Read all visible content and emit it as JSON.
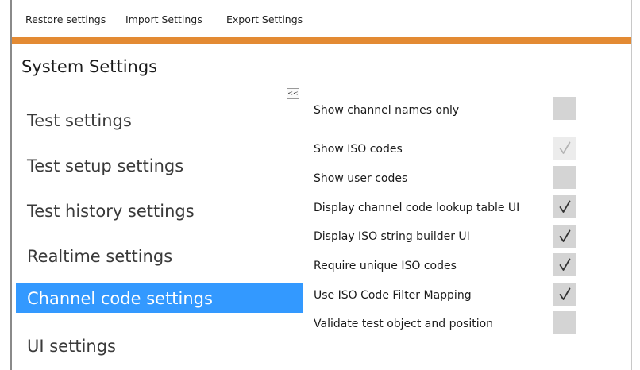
{
  "menu": {
    "restore": "Restore settings",
    "import": "Import Settings",
    "export": "Export Settings"
  },
  "title": "System Settings",
  "collapse_button": "<<",
  "colors": {
    "accent_band": "#e38a33",
    "selected_nav": "#3399ff",
    "checkbox_bg": "#d4d4d4"
  },
  "nav": {
    "items": [
      {
        "label": "Test settings",
        "selected": false
      },
      {
        "label": "Test setup settings",
        "selected": false
      },
      {
        "label": "Test history settings",
        "selected": false
      },
      {
        "label": "Realtime settings",
        "selected": false
      },
      {
        "label": "Channel code settings",
        "selected": true
      },
      {
        "label": "UI settings",
        "selected": false
      }
    ]
  },
  "settings": [
    {
      "label": "Show channel names only",
      "checked": false,
      "enabled": true
    },
    {
      "label": "Show ISO codes",
      "checked": true,
      "enabled": false
    },
    {
      "label": "Show user codes",
      "checked": false,
      "enabled": true
    },
    {
      "label": "Display channel code lookup table UI",
      "checked": true,
      "enabled": true
    },
    {
      "label": "Display ISO string builder UI",
      "checked": true,
      "enabled": true
    },
    {
      "label": "Require unique ISO codes",
      "checked": true,
      "enabled": true
    },
    {
      "label": "Use ISO Code Filter Mapping",
      "checked": true,
      "enabled": true
    },
    {
      "label": "Validate test object and position",
      "checked": false,
      "enabled": true
    }
  ]
}
